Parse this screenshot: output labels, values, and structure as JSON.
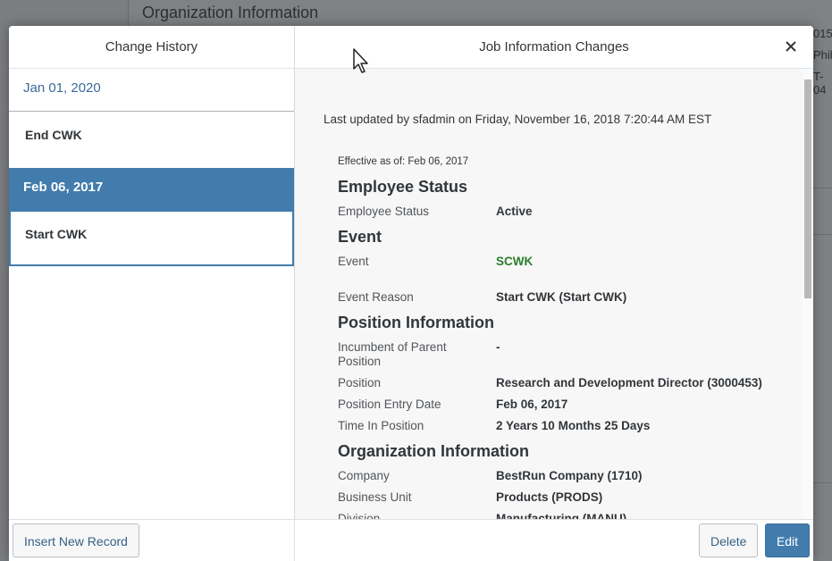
{
  "background": {
    "title": "Organization Information",
    "right_snippets": [
      "015",
      "Phila",
      "T-04"
    ]
  },
  "dialog": {
    "left_header": "Change History",
    "right_header": "Job Information Changes",
    "close_icon": "close-icon",
    "history": [
      {
        "date": "Jan 01, 2020",
        "label": "End CWK",
        "selected": false
      },
      {
        "date": "Feb 06, 2017",
        "label": "Start CWK",
        "selected": true
      }
    ],
    "last_updated": "Last updated by sfadmin on Friday, November 16, 2018 7:20:44 AM EST",
    "effective": "Effective as of: Feb 06, 2017",
    "sections": {
      "employee_status": {
        "title": "Employee Status",
        "fields": [
          {
            "label": "Employee Status",
            "value": "Active"
          }
        ]
      },
      "event": {
        "title": "Event",
        "fields": [
          {
            "label": "Event",
            "value": "SCWK"
          },
          {
            "label": "Event Reason",
            "value": "Start CWK (Start CWK)"
          }
        ]
      },
      "position": {
        "title": "Position Information",
        "fields": [
          {
            "label": "Incumbent of Parent Position",
            "value": "-"
          },
          {
            "label": "Position",
            "value": "Research and Development Director (3000453)"
          },
          {
            "label": "Position Entry Date",
            "value": "Feb 06, 2017"
          },
          {
            "label": "Time In Position",
            "value": "2 Years 10 Months 25 Days"
          }
        ]
      },
      "organization": {
        "title": "Organization Information",
        "fields": [
          {
            "label": "Company",
            "value": "BestRun Company (1710)"
          },
          {
            "label": "Business Unit",
            "value": "Products (PRODS)"
          },
          {
            "label": "Division",
            "value": "Manufacturing (MANU)"
          }
        ]
      }
    },
    "footer": {
      "insert_label": "Insert New Record",
      "delete_label": "Delete",
      "edit_label": "Edit"
    }
  },
  "colors": {
    "accent": "#427cac",
    "event_value_green": "#2b7d2b",
    "link_blue": "#3c6a99"
  }
}
